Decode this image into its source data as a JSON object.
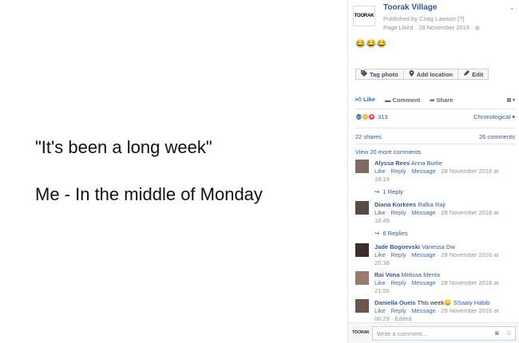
{
  "photo": {
    "line1": "\"It's been a long week\"",
    "line2": "Me - In the middle of Monday"
  },
  "post": {
    "page_logo": "TOORAK",
    "page_name": "Toorak Village",
    "published_by": "Published by Craig Lawson [?]",
    "page_liked": "Page Liked · 28 November 2016 ·",
    "emojis": "😂😂😂"
  },
  "tag_bar": {
    "tag_photo": "Tag photo",
    "add_location": "Add location",
    "edit": "Edit"
  },
  "actions": {
    "like": "Like",
    "comment": "Comment",
    "share": "Share"
  },
  "reactions": {
    "count": "313",
    "sort": "Chronological"
  },
  "stats": {
    "shares": "22 shares",
    "comments": "26 comments"
  },
  "more_comments": "View 20 more comments",
  "comments": [
    {
      "author": "Alyssa Rees",
      "tag": "Anna Burke",
      "text": "",
      "like": "Like",
      "reply": "Reply",
      "message": "Message",
      "time": "28 November 2016 at 18:19",
      "replies": "1 Reply"
    },
    {
      "author": "Diana Korkees",
      "tag": "Rafka Raji",
      "text": "",
      "like": "Like",
      "reply": "Reply",
      "message": "Message",
      "time": "28 November 2016 at 18:49",
      "replies": "6 Replies"
    },
    {
      "author": "Jade Bogoevski",
      "tag": "Vanessa Dw",
      "text": "",
      "like": "Like",
      "reply": "Reply",
      "message": "Message",
      "time": "28 November 2016 at 20:38",
      "replies": ""
    },
    {
      "author": "Rai Vona",
      "tag": "Melissa Menta",
      "text": "",
      "like": "Like",
      "reply": "Reply",
      "message": "Message",
      "time": "28 November 2016 at 21:00",
      "replies": ""
    },
    {
      "author": "Daniella Oueis",
      "tag": "SSaaly Habib",
      "text": "This week😞",
      "like": "Like",
      "reply": "Reply",
      "message": "Message",
      "time": "29 November 2016 at 06:29 · Edited",
      "replies": ""
    }
  ],
  "write_comment": {
    "logo": "TOORAK",
    "placeholder": "Write a comment..."
  },
  "colors": {
    "link": "#365899",
    "muted": "#90949c",
    "like_blue": "#4267b2"
  }
}
